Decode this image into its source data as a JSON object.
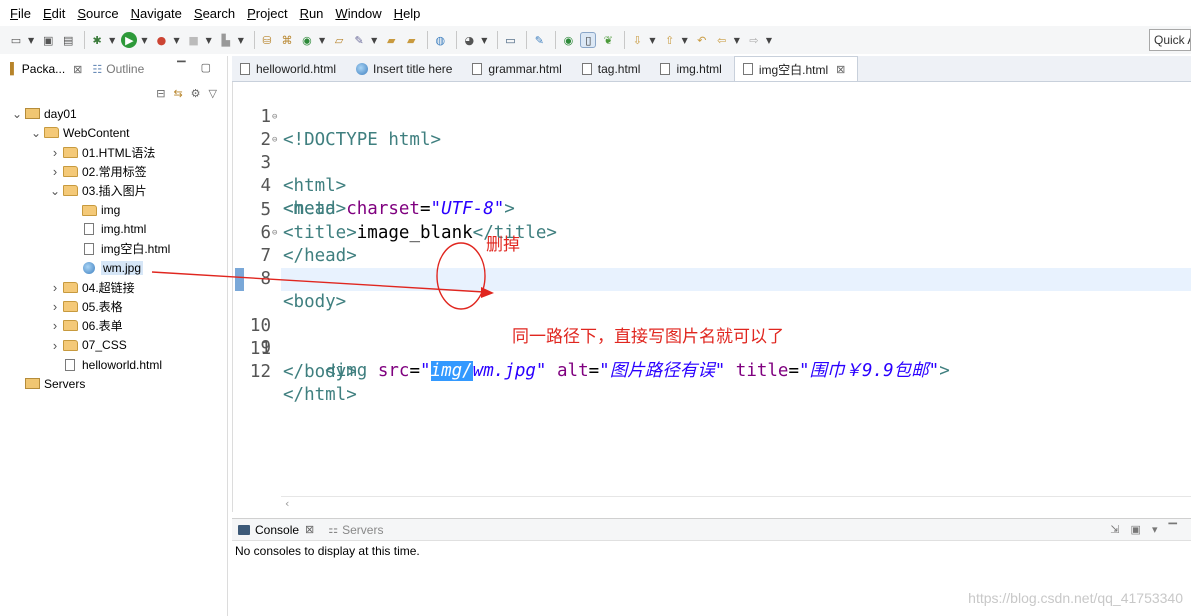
{
  "menubar": {
    "items": [
      "File",
      "Edit",
      "Source",
      "Navigate",
      "Search",
      "Project",
      "Run",
      "Window",
      "Help"
    ]
  },
  "toolbar": {
    "quick_access": "Quick Access"
  },
  "left_panel": {
    "tabs": [
      "Packa...",
      "Outline"
    ],
    "tree": [
      {
        "label": "day01",
        "level": 0,
        "icon": "project-icon",
        "expanded": true
      },
      {
        "label": "WebContent",
        "level": 1,
        "icon": "folder-icon",
        "expanded": true
      },
      {
        "label": "01.HTML语法",
        "level": 2,
        "icon": "folder-icon",
        "expanded": false
      },
      {
        "label": "02.常用标签",
        "level": 2,
        "icon": "folder-icon",
        "expanded": false
      },
      {
        "label": "03.插入图片",
        "level": 2,
        "icon": "folder-icon",
        "expanded": true
      },
      {
        "label": "img",
        "level": 3,
        "icon": "folder-icon"
      },
      {
        "label": "img.html",
        "level": 3,
        "icon": "file-icon"
      },
      {
        "label": "img空白.html",
        "level": 3,
        "icon": "file-icon"
      },
      {
        "label": "wm.jpg",
        "level": 3,
        "icon": "image-icon",
        "selected": true
      },
      {
        "label": "04.超链接",
        "level": 2,
        "icon": "folder-icon",
        "expanded": false
      },
      {
        "label": "05.表格",
        "level": 2,
        "icon": "folder-icon",
        "expanded": false
      },
      {
        "label": "06.表单",
        "level": 2,
        "icon": "folder-icon",
        "expanded": false
      },
      {
        "label": "07_CSS",
        "level": 2,
        "icon": "folder-icon",
        "expanded": false
      },
      {
        "label": "helloworld.html",
        "level": 2,
        "icon": "file-icon"
      },
      {
        "label": "Servers",
        "level": 0,
        "icon": "servers-icon"
      }
    ]
  },
  "editor": {
    "tabs": [
      {
        "label": "helloworld.html",
        "icon": "file-icon"
      },
      {
        "label": "Insert title here",
        "icon": "globe-icon"
      },
      {
        "label": "grammar.html",
        "icon": "file-icon"
      },
      {
        "label": "tag.html",
        "icon": "file-icon"
      },
      {
        "label": "img.html",
        "icon": "file-icon"
      },
      {
        "label": "img空白.html",
        "icon": "file-icon",
        "active": true
      }
    ],
    "lines": [
      {
        "n": "1",
        "fold": ""
      },
      {
        "n": "2",
        "fold": "⊖"
      },
      {
        "n": "3",
        "fold": "⊖"
      },
      {
        "n": "4",
        "fold": ""
      },
      {
        "n": "5",
        "fold": ""
      },
      {
        "n": "6",
        "fold": ""
      },
      {
        "n": "7",
        "fold": "⊖"
      },
      {
        "n": "8",
        "fold": ""
      },
      {
        "n": "9",
        "fold": ""
      },
      {
        "n": "10",
        "fold": ""
      },
      {
        "n": "11",
        "fold": ""
      },
      {
        "n": "12",
        "fold": ""
      }
    ],
    "code": {
      "l1": "<!DOCTYPE html>",
      "l2": "<html>",
      "l3": "<head>",
      "l4_tag": "<meta ",
      "l4_attr": "charset",
      "l4_eq": "=",
      "l4_val": "\"UTF-8\"",
      "l4_end": ">",
      "l5_open": "<title>",
      "l5_text": "image_blank",
      "l5_close": "</title>",
      "l6": "</head>",
      "l7": "<body>",
      "l9_indent": "    ",
      "l9_tag": "<img ",
      "l9_attr1": "src",
      "l9_eq1": "=",
      "l9_q1": "\"",
      "l9_sel": "img/",
      "l9_rest": "wm.jpg\"",
      "l9_attr2": " alt",
      "l9_eq2": "=",
      "l9_val2": "\"图片路径有误\"",
      "l9_attr3": " title",
      "l9_eq3": "=",
      "l9_val3": "\"围巾￥9.9包邮\"",
      "l9_end": ">",
      "l11": "</body>",
      "l12": "</html>"
    }
  },
  "console": {
    "tabs": [
      "Console",
      "Servers"
    ],
    "message": "No consoles to display at this time."
  },
  "annotations": {
    "delete_label": "删掉",
    "note": "同一路径下，直接写图片名就可以了",
    "color": "#e0261f"
  },
  "watermark": "https://blog.csdn.net/qq_41753340"
}
